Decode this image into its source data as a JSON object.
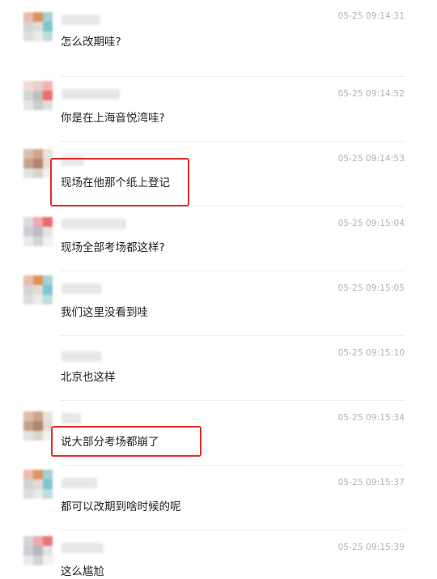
{
  "colors": {
    "highlight": "#e0302b",
    "timestamp": "#b3b3b3",
    "text": "#222222",
    "divider": "#ededed"
  },
  "messages": [
    {
      "time": "05-25 09:14:31",
      "text": "怎么改期哇?",
      "avatar": [
        "#e8b4a8",
        "#d98a4a",
        "#9ccbd0",
        "#cfcfcf",
        "#e0d8d4",
        "#6fc0c6",
        "#dadada",
        "#e8e8e8",
        "#b9d9dc"
      ],
      "highlighted": false
    },
    {
      "time": "05-25 09:14:52",
      "text": "你是在上海音悦湾哇?",
      "avatar": [
        "#f0d8d0",
        "#e9c8c8",
        "#f4a8a8",
        "#d0d0d0",
        "#b8b8b8",
        "#e86060",
        "#e4e4e4",
        "#c8c8c8",
        "#dcdcdc"
      ],
      "highlighted": false
    },
    {
      "time": "05-25 09:14:53",
      "text": "现场在他那个纸上登记",
      "avatar": [
        "#d8b8a8",
        "#c89a80",
        "#e8e0d8",
        "#c09880",
        "#a87860",
        "#e8d8d0",
        "#e0e0e0",
        "#d8d0c8",
        "#f0f0f0"
      ],
      "highlighted": true
    },
    {
      "time": "05-25 09:15:04",
      "text": "现场全部考场都这样?",
      "avatar": [
        "#d8d8e0",
        "#f0a0a0",
        "#e85858",
        "#c8c8d0",
        "#b8b8c0",
        "#e0e0e0",
        "#e8e8e8",
        "#d0d0d0",
        "#f0f0f0"
      ],
      "highlighted": false
    },
    {
      "time": "05-25 09:15:05",
      "text": "我们这里没看到哇",
      "avatar": [
        "#e8b4a8",
        "#d98a4a",
        "#9ccbd0",
        "#cfcfcf",
        "#e0d8d4",
        "#6fc0c6",
        "#dadada",
        "#e8e8e8",
        "#b9d9dc"
      ],
      "highlighted": false
    },
    {
      "time": "05-25 09:15:10",
      "text": "北京也这样",
      "avatar": null,
      "highlighted": false
    },
    {
      "time": "05-25 09:15:34",
      "text": "说大部分考场都崩了",
      "avatar": [
        "#d8b8a8",
        "#c89a80",
        "#e8e0d8",
        "#c09880",
        "#a87860",
        "#e8d8d0",
        "#e0e0e0",
        "#d8d0c8",
        "#f0f0f0"
      ],
      "highlighted": true
    },
    {
      "time": "05-25 09:15:37",
      "text": "都可以改期到啥时候的呢",
      "avatar": [
        "#e8b4a8",
        "#d98a4a",
        "#9ccbd0",
        "#cfcfcf",
        "#e0d8d4",
        "#6fc0c6",
        "#dadada",
        "#e8e8e8",
        "#b9d9dc"
      ],
      "highlighted": false
    },
    {
      "time": "05-25 09:15:39",
      "text": "这么尴尬",
      "avatar": [
        "#d0d0d8",
        "#f0a0a0",
        "#e86868",
        "#c8c8d0",
        "#b0b0b8",
        "#e0e0e0",
        "#e8e8e8",
        "#d0d0d0",
        "#f0f0f0"
      ],
      "highlighted": false
    }
  ]
}
